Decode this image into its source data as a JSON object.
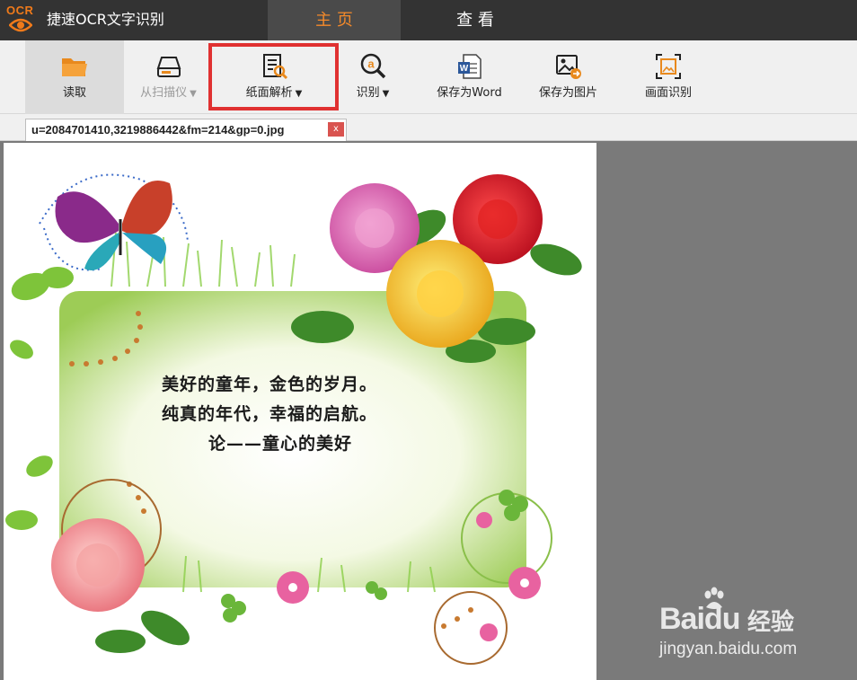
{
  "app": {
    "logo_text": "OCR",
    "title": "捷速OCR文字识别"
  },
  "main_tabs": [
    {
      "label": "主 页",
      "active": true
    },
    {
      "label": "查 看",
      "active": false
    }
  ],
  "toolbar": {
    "read_label": "读取",
    "scanner_label": "从扫描仪",
    "paper_analysis_label": "纸面解析",
    "recognize_label": "识别",
    "save_word_label": "保存为Word",
    "save_image_label": "保存为图片",
    "area_recognize_label": "画面识别",
    "dropdown_caret": "▼"
  },
  "document_tab": {
    "filename": "u=2084701410,3219886442&fm=214&gp=0.jpg",
    "close_label": "x"
  },
  "image_text": {
    "line1": "美好的童年，金色的岁月。",
    "line2": "纯真的年代，幸福的启航。",
    "line3": "论——童心的美好"
  },
  "watermark": {
    "brand": "Bai",
    "brand_suffix": "du",
    "product": "经验",
    "url": "jingyan.baidu.com"
  },
  "colors": {
    "accent": "#f58a2a",
    "titlebar": "#333333",
    "highlight": "#e03131",
    "toolbar_bg": "#f0f0f0"
  }
}
